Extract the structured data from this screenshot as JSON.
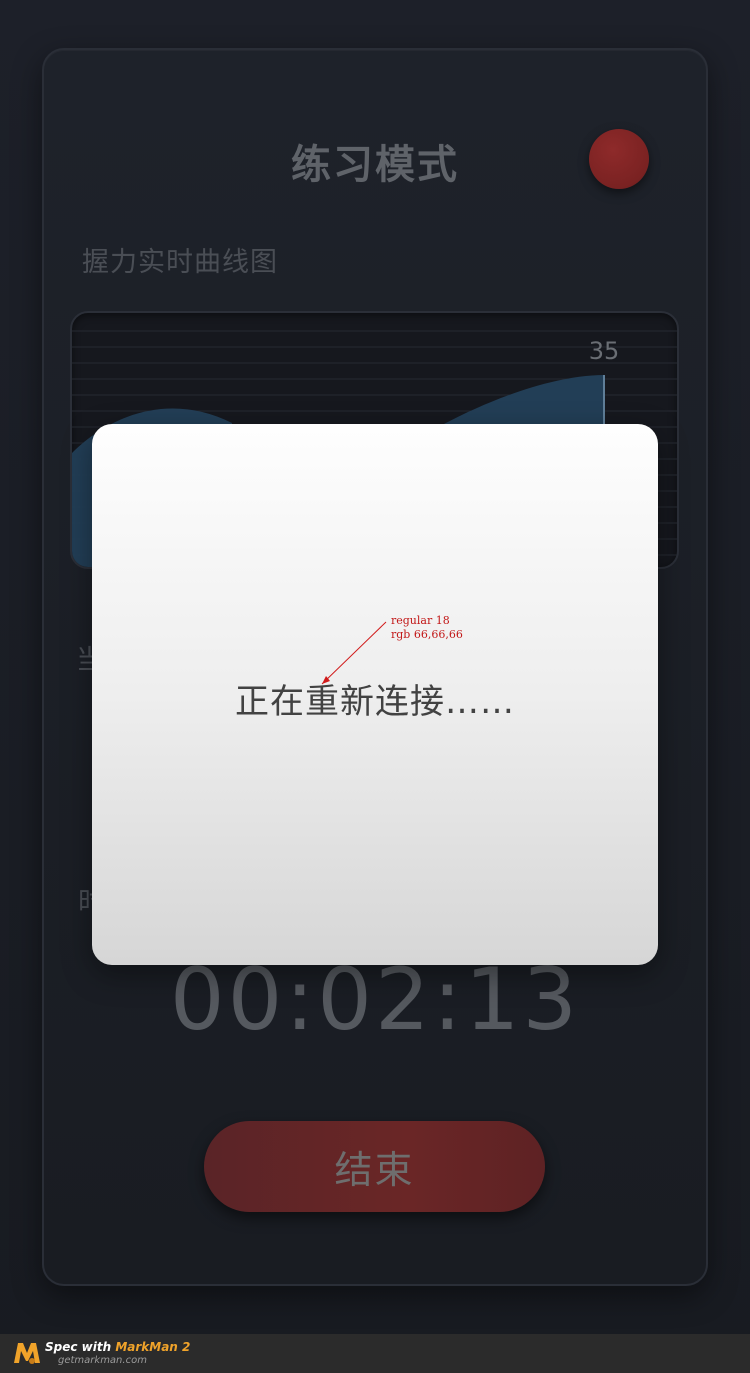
{
  "header": {
    "title": "练习模式"
  },
  "grip_chart": {
    "label": "握力实时曲线图",
    "peak_label": "35"
  },
  "chart_data": {
    "type": "area",
    "title": "握力实时曲线图",
    "annotations": [
      "35"
    ]
  },
  "current_label_partial": "当",
  "time_label_partial": "时",
  "timer": {
    "value": "00:02:13"
  },
  "end_button": {
    "label": "结束"
  },
  "dialog": {
    "message": "正在重新连接……"
  },
  "annotation": {
    "line1": "regular 18",
    "line2": "rgb 66,66,66"
  },
  "footer": {
    "spec_prefix": "Spec with ",
    "brand": "MarkMan 2",
    "url": "getmarkman.com"
  },
  "colors": {
    "accent_red": "#7a2222",
    "dialog_text": "#424242",
    "chart_fill": "#23405a"
  }
}
